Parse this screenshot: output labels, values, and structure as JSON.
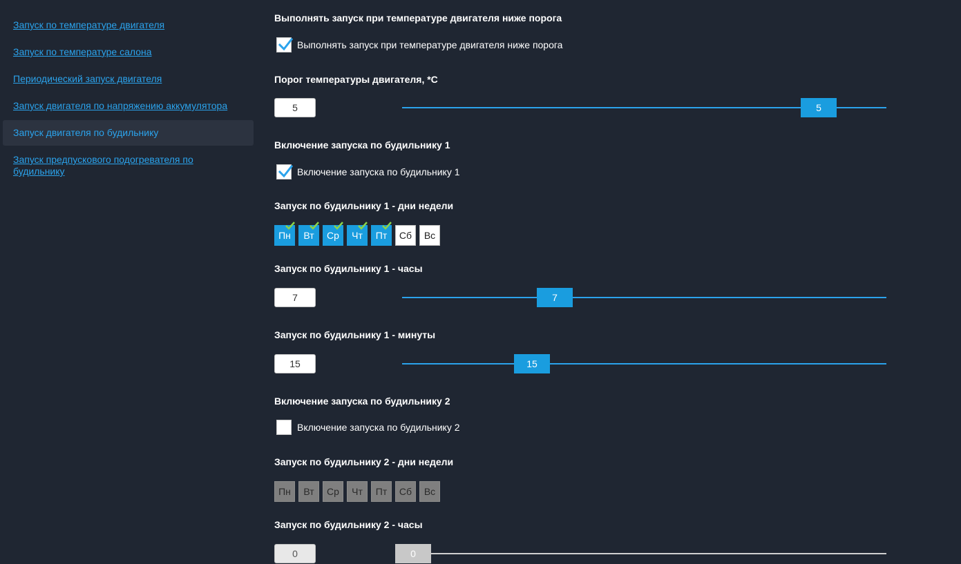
{
  "sidebar": {
    "items": [
      {
        "label": "Запуск по температуре двигателя",
        "active": false
      },
      {
        "label": "Запуск по температуре салона",
        "active": false
      },
      {
        "label": "Периодический запуск двигателя",
        "active": false
      },
      {
        "label": "Запуск двигателя по напряжению аккумулятора",
        "active": false
      },
      {
        "label": "Запуск двигателя по будильнику",
        "active": true
      },
      {
        "label": "Запуск предпускового подогревателя по будильнику",
        "active": false
      }
    ]
  },
  "colors": {
    "background": "#1f2632",
    "accent": "#1a9ddf",
    "link": "#2ba3ec",
    "check": "#2ba3ec",
    "day_tick": "#8bd34a"
  },
  "sections": {
    "below_threshold": {
      "title": "Выполнять запуск при температуре двигателя ниже порога",
      "checkbox_label": "Выполнять запуск при температуре двигателя ниже порога",
      "checked": true
    },
    "engine_threshold": {
      "title": "Порог температуры двигателя, *С",
      "value": "5",
      "min": -20,
      "max": 7.7,
      "level": 0.889
    },
    "alarm1_enable": {
      "title": "Включение запуска по будильнику 1",
      "checkbox_label": "Включение запуска по будильнику 1",
      "checked": true
    },
    "alarm1_days": {
      "title": "Запуск по будильнику 1 - дни недели",
      "days": [
        {
          "label": "Пн",
          "selected": true
        },
        {
          "label": "Вт",
          "selected": true
        },
        {
          "label": "Ср",
          "selected": true
        },
        {
          "label": "Чт",
          "selected": true
        },
        {
          "label": "Пт",
          "selected": true
        },
        {
          "label": "Сб",
          "selected": false
        },
        {
          "label": "Вс",
          "selected": false
        }
      ]
    },
    "alarm1_hours": {
      "title": "Запуск по будильнику 1 - часы",
      "value": "7",
      "level": 0.3
    },
    "alarm1_minutes": {
      "title": "Запуск по будильнику 1 - минуты",
      "value": "15",
      "level": 0.25
    },
    "alarm2_enable": {
      "title": "Включение запуска по будильнику 2",
      "checkbox_label": "Включение запуска по будильнику 2",
      "checked": false
    },
    "alarm2_days": {
      "title": "Запуск по будильнику 2 - дни недели",
      "days": [
        {
          "label": "Пн"
        },
        {
          "label": "Вт"
        },
        {
          "label": "Ср"
        },
        {
          "label": "Чт"
        },
        {
          "label": "Пт"
        },
        {
          "label": "Сб"
        },
        {
          "label": "Вс"
        }
      ]
    },
    "alarm2_hours": {
      "title": "Запуск по будильнику 2 - часы",
      "value": "0",
      "level": 0
    }
  }
}
